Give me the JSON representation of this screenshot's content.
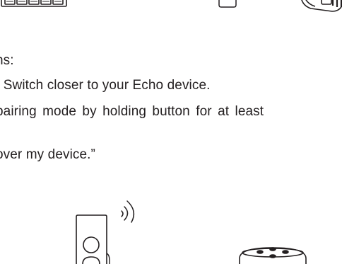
{
  "instructions": {
    "line1": "ns:",
    "line2": ": Switch closer to your Echo device.",
    "line3": " pairing mode by holding button for at least",
    "line4": "over my device.”"
  },
  "icons": {
    "hub": "hub-illustration-icon",
    "remote": "remote-illustration-icon",
    "smart_switch": "smart-switch-illustration-icon",
    "wireless": "wireless-signal-icon",
    "echo": "echo-speaker-icon"
  },
  "colors": {
    "ink": "#231f20",
    "background": "#ffffff"
  }
}
